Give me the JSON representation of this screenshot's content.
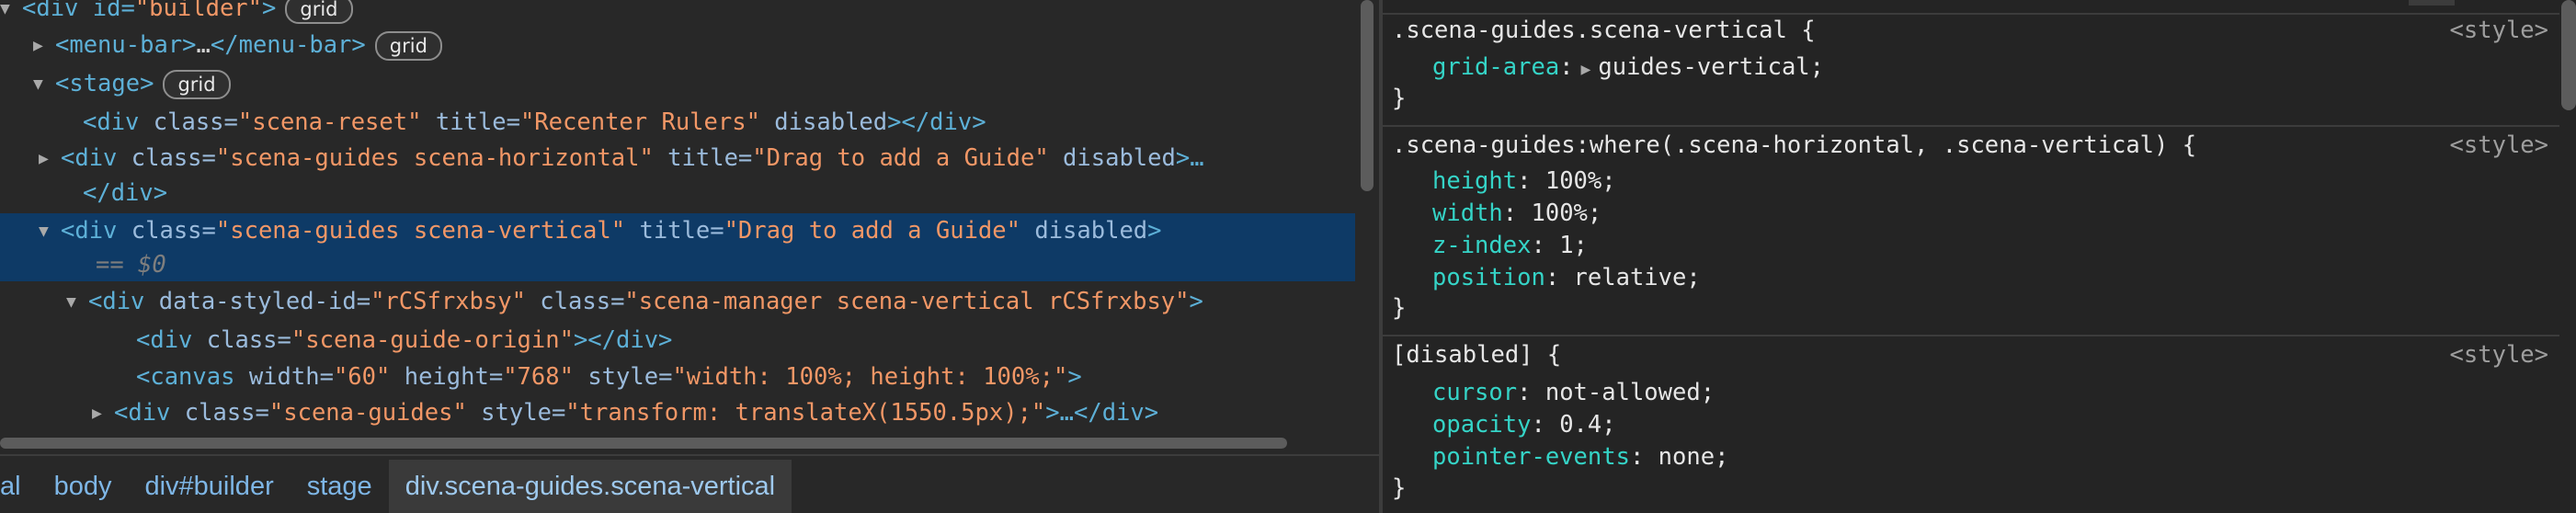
{
  "dom_tree": {
    "rows": [
      {
        "pre": "<div id=",
        "attr": "",
        "val": "\"builder\"",
        "post": ">",
        "badge": "grid"
      },
      {
        "tag": "<menu-bar>",
        "dots": "…",
        "close": "</menu-bar>",
        "badge": "grid"
      },
      {
        "tag": "<stage>",
        "badge": "grid"
      },
      {
        "open": "<div ",
        "a1": "class=",
        "v1": "\"scena-reset\"",
        "a2": " title=",
        "v2": "\"Recenter Rulers\"",
        "a3": " disabled",
        "close": "></div>"
      },
      {
        "open": "<div ",
        "a1": "class=",
        "v1": "\"scena-guides scena-horizontal\"",
        "a2": " title=",
        "v2": "\"Drag to add a Guide\"",
        "a3": " disabled",
        "close": ">…"
      },
      {
        "close": "</div>"
      },
      {
        "open": "<div ",
        "a1": "class=",
        "v1": "\"scena-guides scena-vertical\"",
        "a2": " title=",
        "v2": "\"Drag to add a Guide\"",
        "a3": " disabled",
        "close": ">"
      },
      {
        "eq": "== $0"
      },
      {
        "open": "<div ",
        "a1": "data-styled-id=",
        "v1": "\"rCSfrxbsy\"",
        "a2": " class=",
        "v2": "\"scena-manager scena-vertical  rCSfrxbsy\"",
        "close": ">"
      },
      {
        "open": "<div ",
        "a1": "class=",
        "v1": "\"scena-guide-origin\"",
        "close": "></div>"
      },
      {
        "open": "<canvas ",
        "a1": "width=",
        "v1": "\"60\"",
        "a2": " height=",
        "v2": "\"768\"",
        "a3": " style=",
        "v3": "\"width: 100%; height: 100%;\"",
        "close": ">"
      },
      {
        "open": "<div ",
        "a1": "class=",
        "v1": "\"scena-guides\"",
        "a2": " style=",
        "v2": "\"transform: translateX(1550.5px);\"",
        "close": ">…</div>"
      }
    ]
  },
  "breadcrumbs": [
    "al",
    "body",
    "div#builder",
    "stage",
    "div.scena-guides.scena-vertical"
  ],
  "styles": {
    "source": "<style>",
    "rule1": {
      "selector": ".scena-guides.scena-vertical {",
      "p1": "grid-area",
      "v1": "guides-vertical;",
      "close": "}"
    },
    "rule2": {
      "selector": ".scena-guides:where(.scena-horizontal, .scena-vertical) {",
      "p1": "height",
      "v1": "100%;",
      "p2": "width",
      "v2": "100%;",
      "p3": "z-index",
      "v3": "1;",
      "p4": "position",
      "v4": "relative;",
      "close": "}"
    },
    "rule3": {
      "selector": "[disabled] {",
      "p1": "cursor",
      "v1": "not-allowed;",
      "p2": "opacity",
      "v2": "0.4;",
      "p3": "pointer-events",
      "v3": "none;",
      "close": "}"
    }
  },
  "colors": {
    "selection": "#0e3a66",
    "tag": "#5db0d7",
    "attr_value": "#f29766",
    "property": "#35d4c7"
  }
}
